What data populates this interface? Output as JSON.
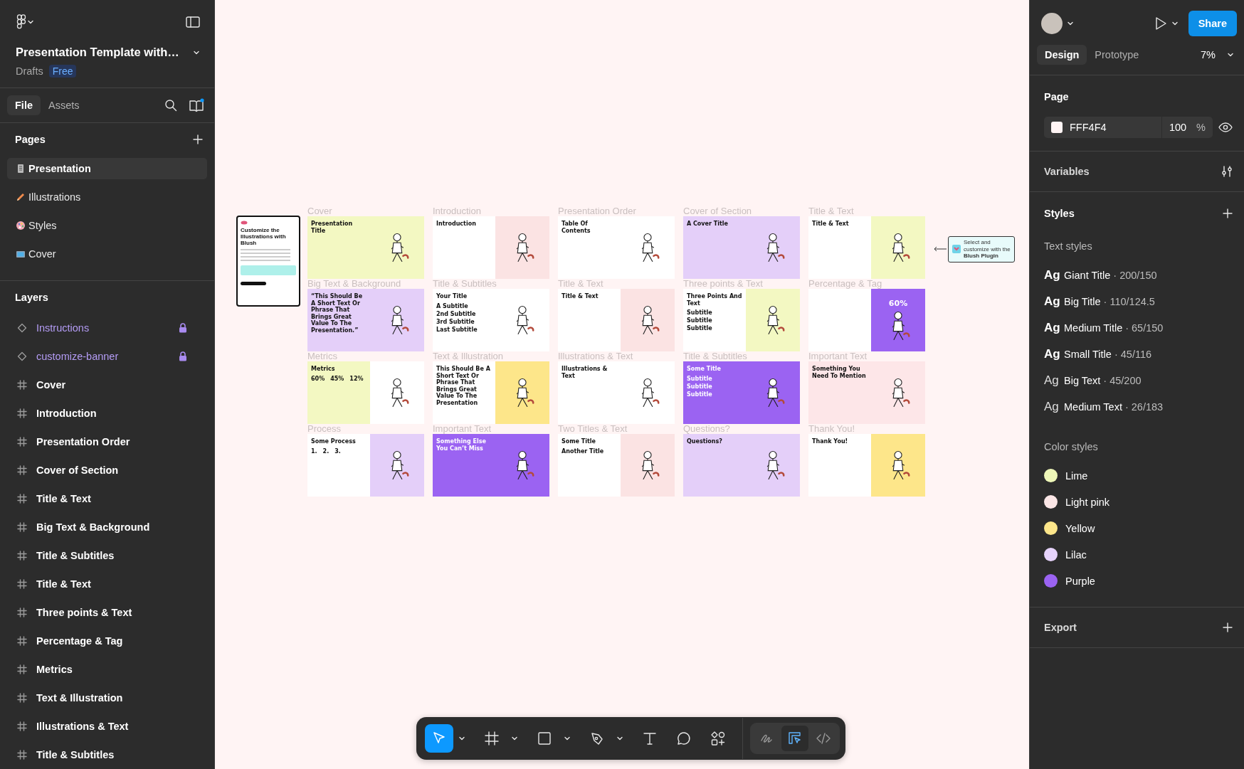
{
  "file": {
    "title": "Presentation Template with…",
    "location": "Drafts",
    "plan": "Free"
  },
  "left_tabs": [
    {
      "label": "File",
      "selected": true
    },
    {
      "label": "Assets",
      "selected": false
    }
  ],
  "pages": {
    "title": "Pages",
    "items": [
      {
        "label": "Presentation",
        "kind": "document",
        "selected": true
      },
      {
        "label": "Illustrations",
        "kind": "pencil",
        "selected": false
      },
      {
        "label": "Styles",
        "kind": "palette",
        "selected": false
      },
      {
        "label": "Cover",
        "kind": "tv",
        "selected": false
      }
    ]
  },
  "layers": {
    "title": "Layers",
    "items": [
      {
        "label": "Instructions",
        "kind": "component",
        "locked": true
      },
      {
        "label": "customize-banner",
        "kind": "component",
        "locked": true
      },
      {
        "label": "Cover",
        "kind": "frame",
        "locked": false
      },
      {
        "label": "Introduction",
        "kind": "frame",
        "locked": false
      },
      {
        "label": "Presentation Order",
        "kind": "frame",
        "locked": false
      },
      {
        "label": "Cover of Section",
        "kind": "frame",
        "locked": false
      },
      {
        "label": "Title & Text",
        "kind": "frame",
        "locked": false
      },
      {
        "label": "Big Text & Background",
        "kind": "frame",
        "locked": false
      },
      {
        "label": "Title & Subtitles",
        "kind": "frame",
        "locked": false
      },
      {
        "label": "Title & Text",
        "kind": "frame",
        "locked": false
      },
      {
        "label": "Three points & Text",
        "kind": "frame",
        "locked": false
      },
      {
        "label": "Percentage & Tag",
        "kind": "frame",
        "locked": false
      },
      {
        "label": "Metrics",
        "kind": "frame",
        "locked": false
      },
      {
        "label": "Text & Illustration",
        "kind": "frame",
        "locked": false
      },
      {
        "label": "Illustrations & Text",
        "kind": "frame",
        "locked": false
      },
      {
        "label": "Title & Subtitles",
        "kind": "frame",
        "locked": false
      }
    ]
  },
  "canvas": {
    "instructions": {
      "title": "Customize the Illustrations with Blush"
    },
    "frames": [
      {
        "label": "Cover",
        "title": "Presentation Title",
        "panels": [
          {
            "color": "#f3f8c2"
          },
          {
            "color": "#f3f8c2"
          }
        ]
      },
      {
        "label": "Introduction",
        "title": "Introduction",
        "panels": [
          {
            "color": "#ffffff"
          },
          {
            "color": "#fbe3e3"
          }
        ]
      },
      {
        "label": "Presentation Order",
        "title": "Table Of Contents",
        "panels": [
          {
            "color": "#ffffff"
          },
          {
            "color": "#ffffff"
          }
        ]
      },
      {
        "label": "Cover of Section",
        "title": "A Cover Title",
        "panels": [
          {
            "color": "#e4cff9"
          },
          {
            "color": "#e4cff9"
          }
        ]
      },
      {
        "label": "Title & Text",
        "title": "Title & Text",
        "panels": [
          {
            "color": "#ffffff"
          },
          {
            "color": "#f3f8c2"
          }
        ]
      },
      {
        "label": "Big Text & Background",
        "title": "“This Should Be A Short Text Or Phrase That Brings Great Value To The Presentation.”",
        "panels": [
          {
            "color": "#e4cff9"
          },
          {
            "color": "#e4cff9"
          }
        ]
      },
      {
        "label": "Title & Subtitles",
        "title": "Your Title",
        "items": [
          "A Subtitle",
          "2nd Subtitle",
          "3rd Subtitle",
          "Last Subtitle"
        ],
        "panels": [
          {
            "color": "#ffffff"
          },
          {
            "color": "#ffffff"
          }
        ]
      },
      {
        "label": "Title & Text",
        "title": "Title & Text",
        "panels": [
          {
            "color": "#ffffff"
          },
          {
            "color": "#fbe3e3"
          }
        ]
      },
      {
        "label": "Three points & Text",
        "title": "Three Points And Text",
        "items": [
          "Subtitle",
          "Subtitle",
          "Subtitle"
        ],
        "panels": [
          {
            "color": "#ffffff"
          },
          {
            "color": "#f3f8c2"
          }
        ]
      },
      {
        "label": "Percentage & Tag",
        "title": "60%",
        "panels": [
          {
            "color": "#ffffff"
          },
          {
            "color": "#9b63f2"
          }
        ]
      },
      {
        "label": "Metrics",
        "title": "Metrics",
        "items": [
          "60%",
          "45%",
          "12%"
        ],
        "panels": [
          {
            "color": "#f3f8c2"
          },
          {
            "color": "#ffffff"
          }
        ]
      },
      {
        "label": "Text & Illustration",
        "title": "This Should Be A Short Text Or Phrase That Brings Great Value To The Presentation",
        "panels": [
          {
            "color": "#ffffff"
          },
          {
            "color": "#fde68a"
          }
        ]
      },
      {
        "label": "Illustrations & Text",
        "title": "Illustrations & Text",
        "panels": [
          {
            "color": "#ffffff"
          },
          {
            "color": "#ffffff"
          }
        ]
      },
      {
        "label": "Title & Subtitles",
        "title": "Some Title",
        "items": [
          "Subtitle",
          "Subtitle",
          "Subtitle"
        ],
        "panels": [
          {
            "color": "#9b63f2"
          },
          {
            "color": "#9b63f2"
          }
        ]
      },
      {
        "label": "Important Text",
        "title": "Something You Need To Mention",
        "panels": [
          {
            "color": "#fde6e8"
          },
          {
            "color": "#fde6e8"
          }
        ]
      },
      {
        "label": "Process",
        "title": "Some Process",
        "items": [
          "1.",
          "2.",
          "3."
        ],
        "panels": [
          {
            "color": "#ffffff"
          },
          {
            "color": "#e4cff9"
          }
        ]
      },
      {
        "label": "Important Text",
        "title": "Something Else You Can’t Miss",
        "panels": [
          {
            "color": "#9b63f2"
          },
          {
            "color": "#9b63f2"
          }
        ]
      },
      {
        "label": "Two Titles & Text",
        "title": "Some Title",
        "items": [
          "Another Title"
        ],
        "panels": [
          {
            "color": "#ffffff"
          },
          {
            "color": "#fbe3e3"
          }
        ]
      },
      {
        "label": "Questions?",
        "title": "Questions?",
        "panels": [
          {
            "color": "#e4cff9"
          },
          {
            "color": "#e4cff9"
          }
        ]
      },
      {
        "label": "Thank You!",
        "title": "Thank You!",
        "panels": [
          {
            "color": "#ffffff"
          },
          {
            "color": "#fde68a"
          }
        ]
      }
    ],
    "banner": {
      "text": "Select and customize with the **Blush Plugin**"
    }
  },
  "toolbar": {
    "tools": [
      {
        "kind": "move",
        "selected": true,
        "menu": true
      },
      {
        "kind": "frame",
        "selected": false,
        "menu": true
      },
      {
        "kind": "rectangle",
        "selected": false,
        "menu": true
      },
      {
        "kind": "pen",
        "selected": false,
        "menu": true
      },
      {
        "kind": "text",
        "selected": false,
        "menu": false
      },
      {
        "kind": "comment",
        "selected": false,
        "menu": false
      },
      {
        "kind": "actions",
        "selected": false,
        "menu": false
      }
    ],
    "modes": [
      {
        "kind": "draw",
        "selected": false
      },
      {
        "kind": "design",
        "selected": true
      },
      {
        "kind": "dev",
        "selected": false
      }
    ]
  },
  "share": "Share",
  "right_tabs": [
    {
      "label": "Design",
      "selected": true
    },
    {
      "label": "Prototype",
      "selected": false
    }
  ],
  "zoom": "7%",
  "page": {
    "title": "Page",
    "color": "FFF4F4",
    "opacity": "100",
    "unit": "%"
  },
  "variables": {
    "title": "Variables"
  },
  "styles": {
    "title": "Styles",
    "text_title": "Text styles",
    "text_styles": [
      {
        "sample": "Ag",
        "name": "Giant Title",
        "spec": "· 200/150",
        "kind": "bold"
      },
      {
        "sample": "Ag",
        "name": "Big Title",
        "spec": "· 110/124.5",
        "kind": "bold"
      },
      {
        "sample": "Ag",
        "name": "Medium Title",
        "spec": "· 65/150",
        "kind": "bold"
      },
      {
        "sample": "Ag",
        "name": "Small Title",
        "spec": "· 45/116",
        "kind": "bold"
      },
      {
        "sample": "Ag",
        "name": "Big Text",
        "spec": "· 45/200",
        "kind": "regular"
      },
      {
        "sample": "Ag",
        "name": "Medium Text",
        "spec": "· 26/183",
        "kind": "regular"
      }
    ],
    "color_title": "Color styles",
    "color_styles": [
      {
        "name": "Lime",
        "color": "#eef7b8"
      },
      {
        "name": "Light pink",
        "color": "#fbe6e6"
      },
      {
        "name": "Yellow",
        "color": "#fde68a"
      },
      {
        "name": "Lilac",
        "color": "#e6d3fb"
      },
      {
        "name": "Purple",
        "color": "#9b63f2"
      }
    ]
  },
  "export": {
    "title": "Export"
  }
}
